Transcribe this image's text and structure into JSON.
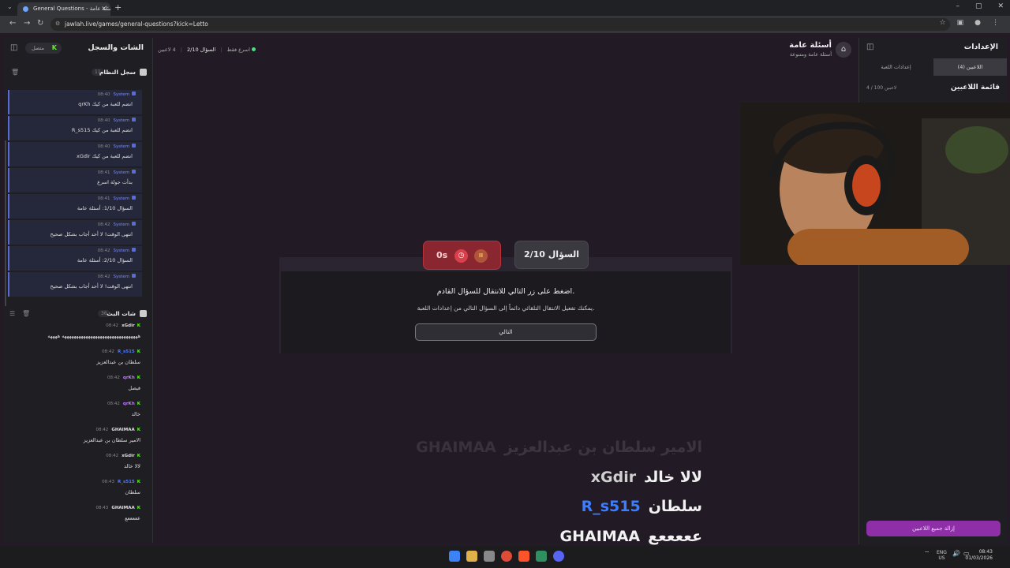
{
  "browser": {
    "tab_title": "General Questions - أسئلة عامة",
    "url": "jawlah.live/games/general-questions?kick=Letto"
  },
  "left_panel": {
    "title": "الشات والسجل",
    "online_label": "متصل",
    "system_log": {
      "title": "سجل النظام",
      "count": "11",
      "items": [
        {
          "sender": "System",
          "time": "08:40",
          "text": "qrKh انضم للعبة من كيك"
        },
        {
          "sender": "System",
          "time": "08:40",
          "text": "R_s515 انضم للعبة من كيك"
        },
        {
          "sender": "System",
          "time": "08:40",
          "text": "xGdir انضم للعبة من كيك"
        },
        {
          "sender": "System",
          "time": "08:41",
          "text": "بدأت جولة اسرع"
        },
        {
          "sender": "System",
          "time": "08:41",
          "text": "السؤال 1/10: أسئلة عامة"
        },
        {
          "sender": "System",
          "time": "08:42",
          "text": "انتهى الوقت! لا أحد أجاب بشكل صحيح"
        },
        {
          "sender": "System",
          "time": "08:42",
          "text": "السؤال 2/10: أسئلة عامة"
        },
        {
          "sender": "System",
          "time": "08:42",
          "text": "انتهى الوقت! لا أحد أجاب بشكل صحيح"
        }
      ]
    },
    "live_chat": {
      "title": "شات البث",
      "count": "36",
      "items": [
        {
          "user": "xGdir",
          "time": "08:42",
          "color": "#e0e0e0",
          "text": "ههههههههههههههههههههههههههههههههه ههههه"
        },
        {
          "user": "R_s515",
          "time": "08:42",
          "color": "#4f7bff",
          "text": "سلطان بن عبدالعزيز"
        },
        {
          "user": "qrKh",
          "time": "08:42",
          "color": "#c07bff",
          "text": "فيصل"
        },
        {
          "user": "qrKh",
          "time": "08:42",
          "color": "#c07bff",
          "text": "خالد"
        },
        {
          "user": "GHAIMAA",
          "time": "08:42",
          "color": "#e0e0e0",
          "text": "الامير سلطان بن عبدالعزيز"
        },
        {
          "user": "xGdir",
          "time": "08:42",
          "color": "#e0e0e0",
          "text": "لالا خالد"
        },
        {
          "user": "R_s515",
          "time": "08:43",
          "color": "#4f7bff",
          "text": "سلطان"
        },
        {
          "user": "GHAIMAA",
          "time": "08:43",
          "color": "#e0e0e0",
          "text": "عععععع"
        }
      ]
    }
  },
  "header": {
    "players_online": "4 لاعبين",
    "question_counter": "السؤال 2/10",
    "mode": "اسرع فقط",
    "game_title": "أسئلة عامة",
    "game_subtitle": "أسئلة عامة ومتنوعة"
  },
  "right_panel": {
    "title": "الإعدادات",
    "tabs": [
      "إعدادات اللعبة",
      "اللاعبين (4)"
    ],
    "players_title": "قائمة اللاعبين",
    "players_count": "4 / 100 لاعبين",
    "remove_all_label": "إزالة جميع اللاعبين"
  },
  "game": {
    "question_badge": "السؤال 2/10",
    "timer_seconds": "0s",
    "timer_icon": "clock-icon",
    "pause_icon": "pause-icon",
    "dialog_title": "اضغط على زر التالي للانتقال للسؤال القادم.",
    "dialog_subtitle": "يمكنك تفعيل الانتقال التلقائي دائماً إلى السؤال التالي من إعدادات اللعبة.",
    "next_label": "التالي"
  },
  "overlay_chat": [
    {
      "user": "GHAIMAA",
      "text": "الامير سلطان بن عبدالعزيز",
      "color": "#d8d8d8",
      "faded": true
    },
    {
      "user": "xGdir",
      "text": "لالا خالد",
      "color": "#d0d0d0"
    },
    {
      "user": "R_s515",
      "text": "سلطان",
      "color": "#3d7dff"
    },
    {
      "user": "GHAIMAA",
      "text": "عععععع",
      "color": "#f2f2f2"
    }
  ],
  "taskbar": {
    "lang": "ENG",
    "region": "US",
    "time": "08:43",
    "date": "01/03/2026"
  },
  "colors": {
    "kick_green": "#53fc18",
    "system_blue": "#5b6bd6",
    "timer_red": "#8a2630",
    "remove_purple": "#8e2fa8"
  }
}
